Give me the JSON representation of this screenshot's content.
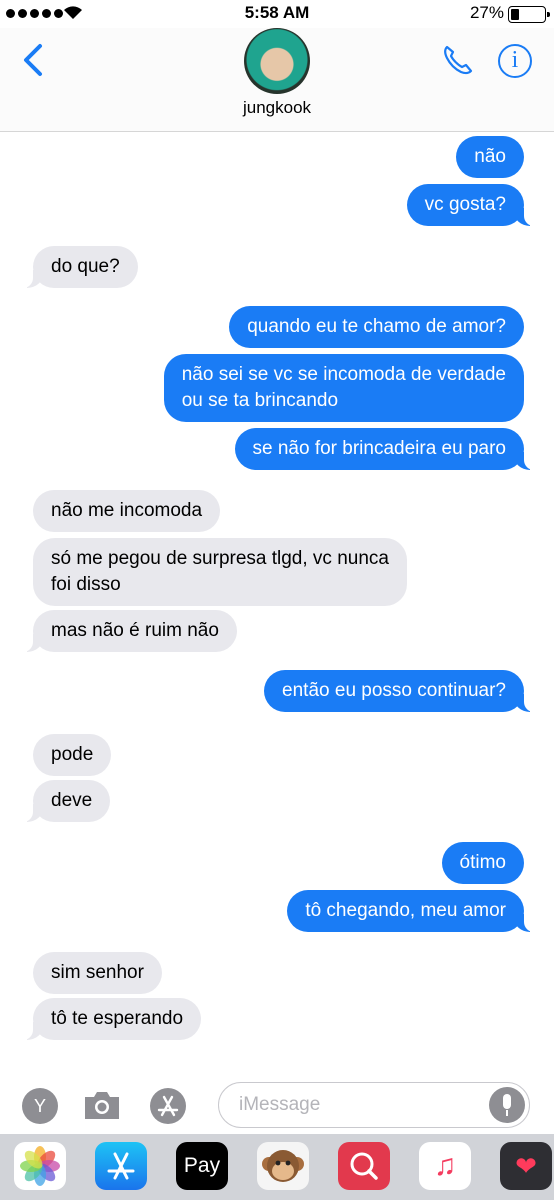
{
  "status_bar": {
    "time": "5:58 AM",
    "battery": "27%"
  },
  "header": {
    "contact_name": "jungkook"
  },
  "messages": [
    {
      "from": "me",
      "text": "não"
    },
    {
      "from": "me",
      "text": "vc gosta?"
    },
    {
      "from": "them",
      "text": "do que?"
    },
    {
      "from": "me",
      "text": "quando eu te chamo de amor?"
    },
    {
      "from": "me",
      "text": "não sei se vc se incomoda de verdade",
      "text2": "ou se ta brincando"
    },
    {
      "from": "me",
      "text": "se não for brincadeira eu paro"
    },
    {
      "from": "them",
      "text": "não me incomoda"
    },
    {
      "from": "them",
      "text": "só me pegou de surpresa tlgd, vc nunca",
      "text2": "foi disso"
    },
    {
      "from": "them",
      "text": "mas não é ruim não"
    },
    {
      "from": "me",
      "text": "então eu posso continuar?"
    },
    {
      "from": "them",
      "text": "pode"
    },
    {
      "from": "them",
      "text": "deve"
    },
    {
      "from": "me",
      "text": "ótimo"
    },
    {
      "from": "me",
      "text": "tô chegando, meu amor"
    },
    {
      "from": "them",
      "text": "sim senhor"
    },
    {
      "from": "them",
      "text": "tô te esperando"
    }
  ],
  "input_bar": {
    "placeholder": "iMessage",
    "y_button": "Y"
  },
  "app_drawer": {
    "apple_pay_label": "Pay"
  },
  "colors": {
    "outgoing": "#1a7cf5",
    "incoming": "#e8e8ed",
    "accent": "#1a7cf5"
  }
}
